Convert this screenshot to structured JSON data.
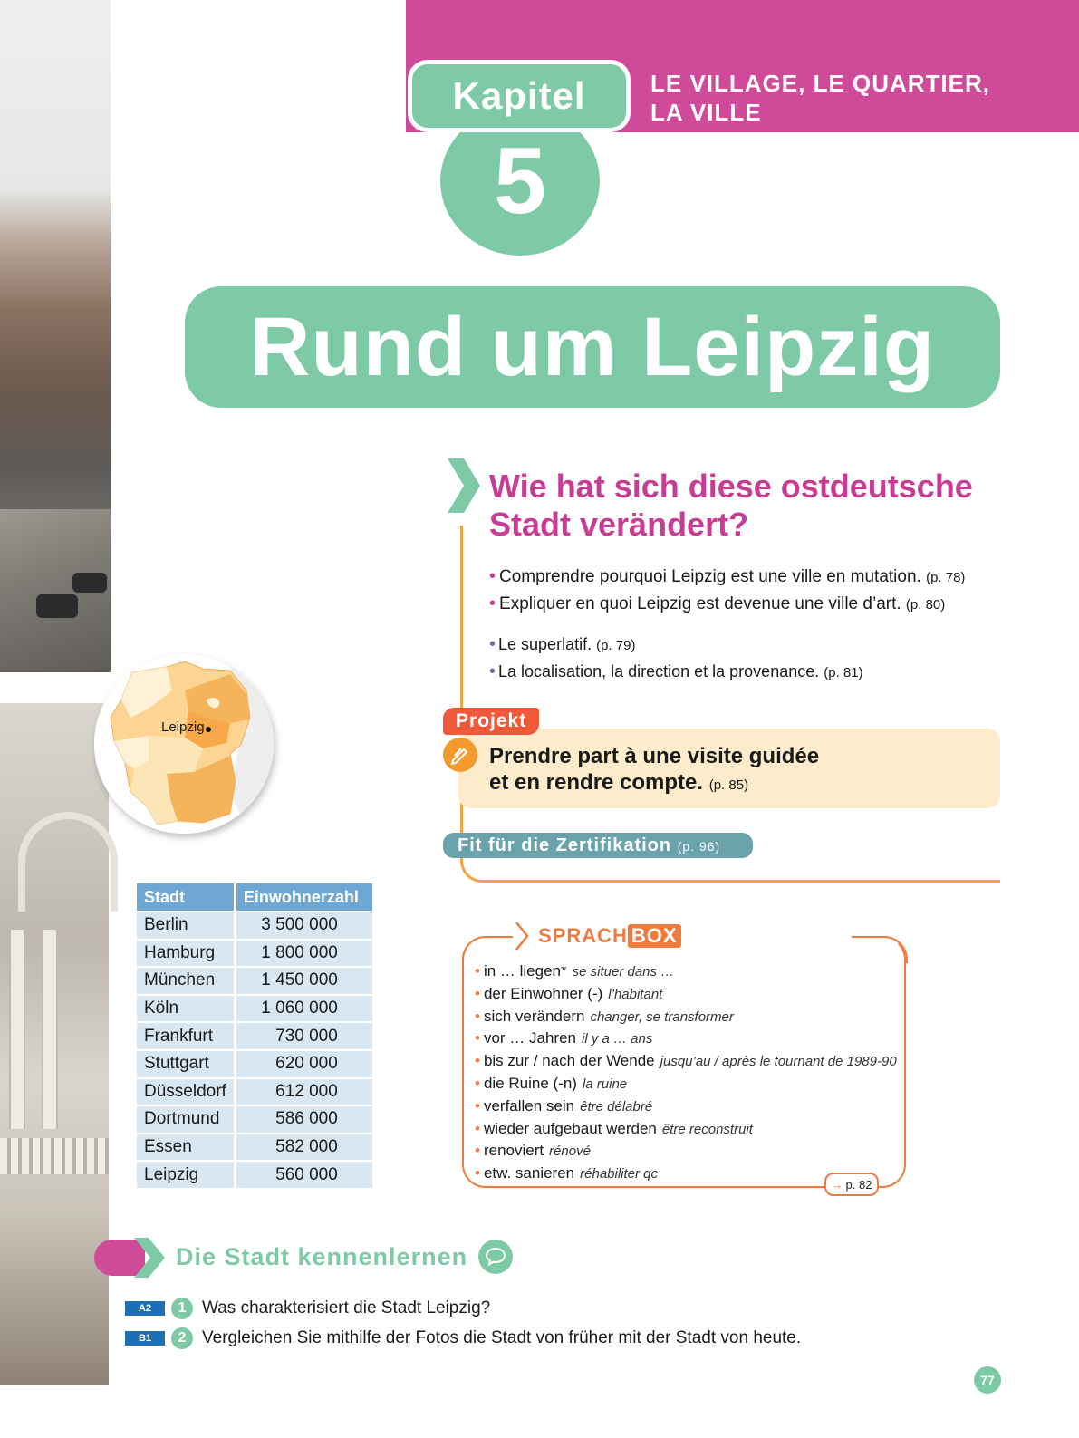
{
  "header": {
    "kapitel_label": "Kapitel",
    "chapter_number": "5",
    "subtitle_line1": "LE VILLAGE, LE QUARTIER,",
    "subtitle_line2": "LA VILLE",
    "title": "Rund um Leipzig"
  },
  "question": {
    "line1": "Wie hat sich diese ostdeutsche",
    "line2": "Stadt verändert?"
  },
  "objectives": [
    {
      "text": "Comprendre pourquoi Leipzig est une ville en mutation.",
      "ref": "(p. 78)"
    },
    {
      "text": "Expliquer en quoi Leipzig est devenue une ville d’art.",
      "ref": "(p. 80)"
    }
  ],
  "grammar": [
    {
      "text": "Le superlatif.",
      "ref": "(p. 79)"
    },
    {
      "text": "La localisation, la direction et la provenance.",
      "ref": "(p. 81)"
    }
  ],
  "projekt": {
    "tag": "Projekt",
    "line1": "Prendre part à une visite guidée",
    "line2": "et en rendre compte.",
    "ref": "(p. 85)"
  },
  "fit": {
    "label": "Fit für die Zertifikation",
    "ref": "(p. 96)"
  },
  "map": {
    "label": "Leipzig"
  },
  "table": {
    "headers": [
      "Stadt",
      "Einwohnerzahl"
    ],
    "rows": [
      [
        "Berlin",
        "3 500 000"
      ],
      [
        "Hamburg",
        "1 800 000"
      ],
      [
        "München",
        "1 450 000"
      ],
      [
        "Köln",
        "1 060 000"
      ],
      [
        "Frankfurt",
        "730 000"
      ],
      [
        "Stuttgart",
        "620 000"
      ],
      [
        "Düsseldorf",
        "612 000"
      ],
      [
        "Dortmund",
        "586 000"
      ],
      [
        "Essen",
        "582 000"
      ],
      [
        "Leipzig",
        "560 000"
      ]
    ]
  },
  "sprachbox": {
    "title_part1": "SPRACH",
    "title_part2": "BOX",
    "items": [
      {
        "de": "in … liegen*",
        "fr": "se situer dans …"
      },
      {
        "de": "der Einwohner (-)",
        "fr": "l’habitant"
      },
      {
        "de": "sich verändern",
        "fr": "changer, se transformer"
      },
      {
        "de": "vor … Jahren",
        "fr": "il y a … ans"
      },
      {
        "de": "bis zur / nach der Wende",
        "fr": "jusqu’au / après le tournant de 1989-90"
      },
      {
        "de": "die Ruine (-n)",
        "fr": "la ruine"
      },
      {
        "de": "verfallen sein",
        "fr": "être délabré"
      },
      {
        "de": "wieder aufgebaut werden",
        "fr": "être reconstruit"
      },
      {
        "de": "renoviert",
        "fr": "rénové"
      },
      {
        "de": "etw. sanieren",
        "fr": "réhabiliter qc"
      }
    ],
    "page_ref": "p. 82"
  },
  "section": {
    "title": "Die Stadt kennenlernen"
  },
  "tasks": [
    {
      "level": "A2",
      "num": "1",
      "text": "Was charakterisiert die Stadt Leipzig?"
    },
    {
      "level": "B1",
      "num": "2",
      "text": "Vergleichen Sie mithilfe der Fotos die Stadt von früher mit der Stadt von heute."
    }
  ],
  "page_number": "77",
  "colors": {
    "magenta": "#d04a9a",
    "mint": "#7fcaa6",
    "orange": "#ef7b3f",
    "table_header": "#6ea6d4",
    "table_cell": "#d9e7f3"
  }
}
